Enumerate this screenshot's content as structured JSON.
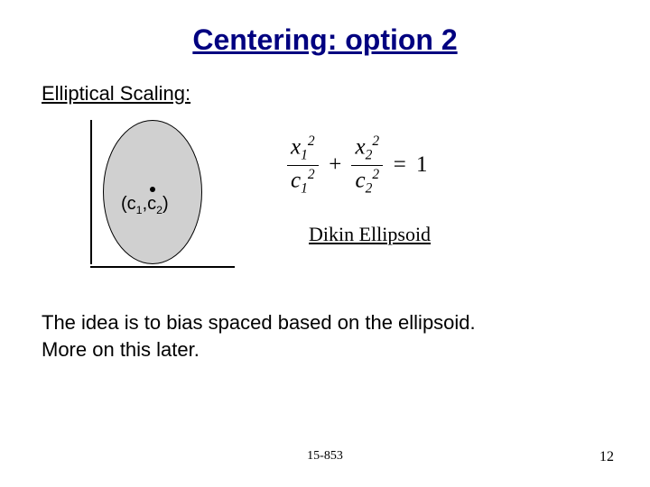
{
  "title": "Centering: option 2",
  "subhead": "Elliptical Scaling:",
  "center_point": {
    "open": "(",
    "c": "c",
    "i1": "1",
    "comma": ",",
    "i2": "2",
    "close": ")"
  },
  "equation": {
    "x": "x",
    "c": "c",
    "i1": "1",
    "i2": "2",
    "sq": "2",
    "plus": "+",
    "eq": "=",
    "one": "1"
  },
  "dikin": "Dikin Ellipsoid",
  "body1": "The idea is to bias spaced based on the ellipsoid.",
  "body2": "More on this later.",
  "footer_center": "15-853",
  "footer_right": "12"
}
